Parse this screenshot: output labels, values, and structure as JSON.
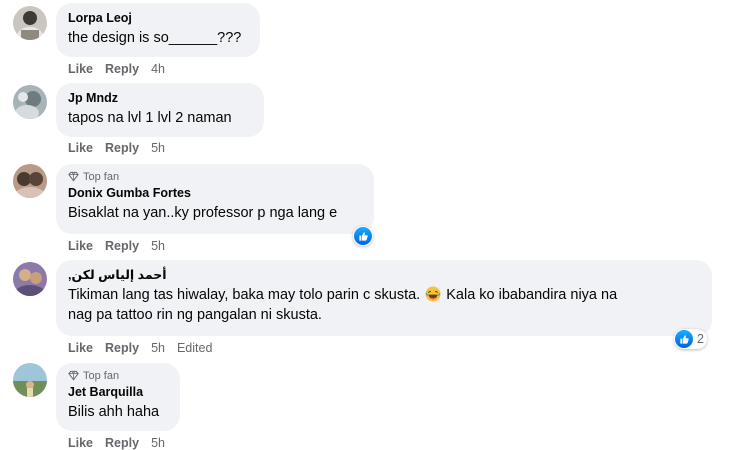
{
  "comments": [
    {
      "author": "Lorpa Leoj",
      "text": "the design is so______???",
      "actions": {
        "like": "Like",
        "reply": "Reply",
        "time": "4h"
      }
    },
    {
      "author": "Jp Mndz",
      "text": "tapos na lvl 1 lvl 2 naman",
      "actions": {
        "like": "Like",
        "reply": "Reply",
        "time": "5h"
      }
    },
    {
      "badge": "Top fan",
      "author": "Donix Gumba Fortes",
      "text": "Bisaklat na yan..ky professor p nga lang e",
      "actions": {
        "like": "Like",
        "reply": "Reply",
        "time": "5h"
      }
    },
    {
      "author": "أحمد إلياس لكن,",
      "text_line1_a": "Tikiman lang tas hiwalay, baka may tolo parin c skusta.",
      "text_line1_b": "Kala ko ibabandira niya na",
      "text_line2": "nag pa tattoo rin ng pangalan ni skusta.",
      "actions": {
        "like": "Like",
        "reply": "Reply",
        "time": "5h",
        "edited": "Edited"
      },
      "reaction_count": "2"
    },
    {
      "badge": "Top fan",
      "author": "Jet Barquilla",
      "text": "Bilis ahh haha",
      "actions": {
        "like": "Like",
        "reply": "Reply",
        "time": "5h"
      }
    }
  ],
  "colors": {
    "bubble": "#f0f2f5",
    "secondary_text": "#65676b",
    "like_blue": "#1877f2"
  }
}
